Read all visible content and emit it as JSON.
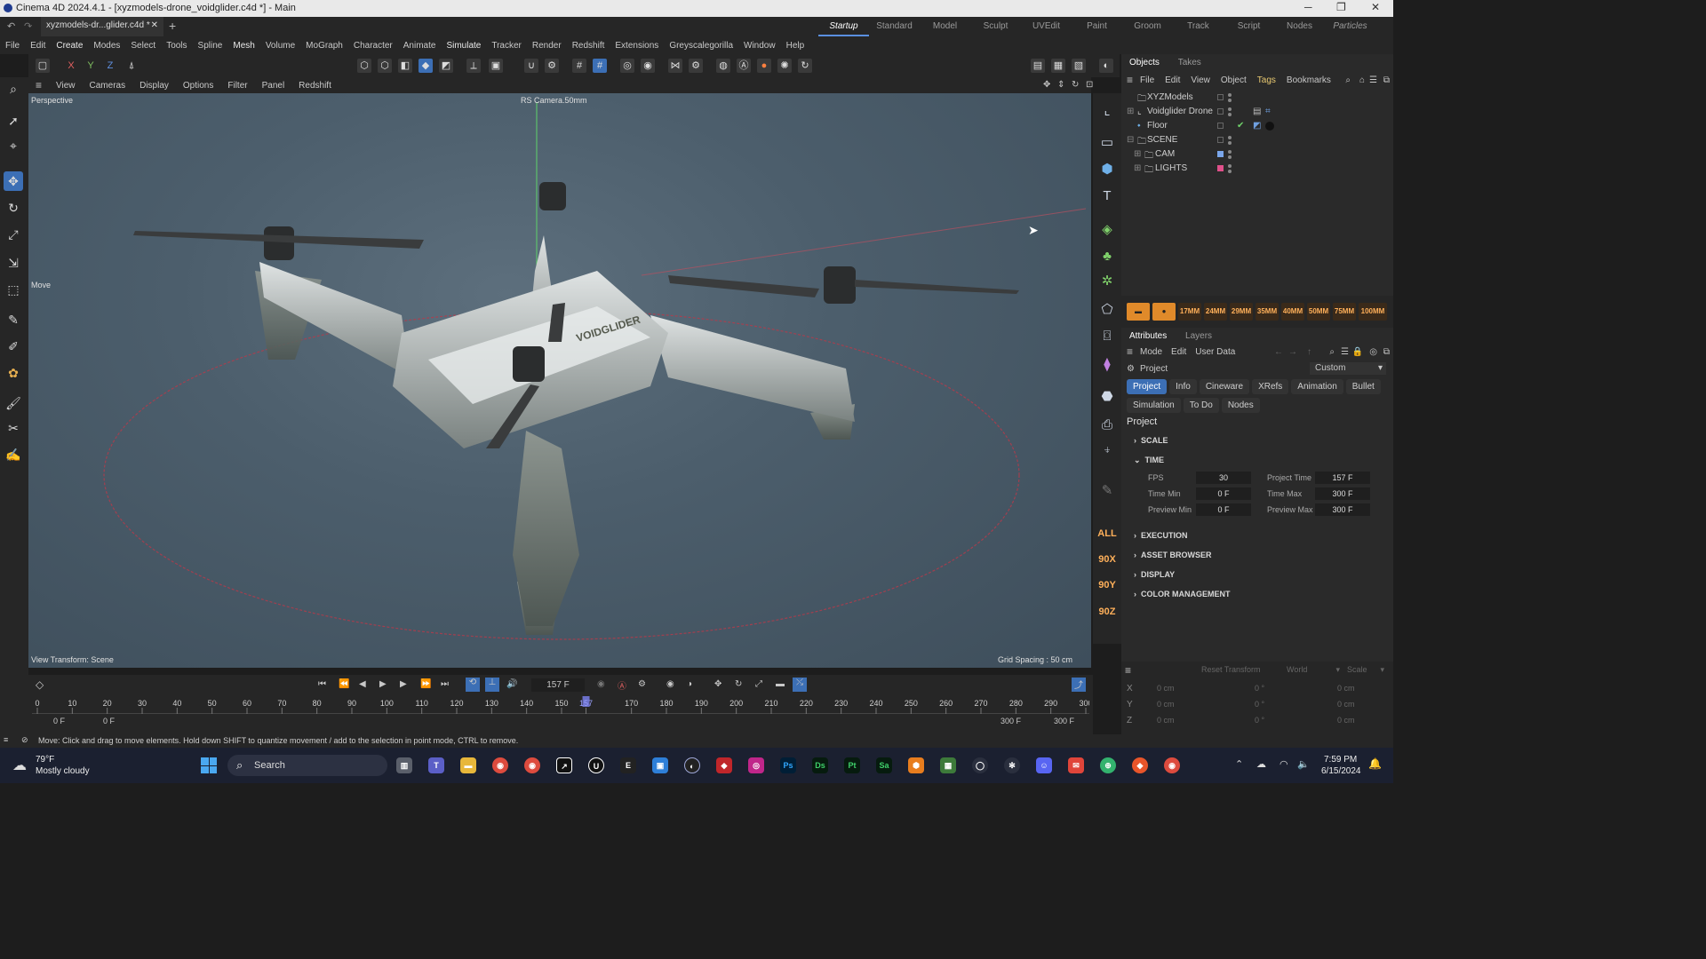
{
  "window": {
    "title": "Cinema 4D 2024.4.1 - [xyzmodels-drone_voidglider.c4d *] - Main",
    "minimize": "─",
    "maximize": "❐",
    "close": "✕"
  },
  "tabbar": {
    "doc_tab": "xyzmodels-dr...glider.c4d *",
    "close": "✕",
    "add": "+",
    "layouts": [
      "Startup",
      "Standard",
      "Model",
      "Sculpt",
      "UVEdit",
      "Paint",
      "Groom",
      "Track",
      "Script",
      "Nodes",
      "Particles"
    ],
    "active_layout": "Startup"
  },
  "menubar": [
    "File",
    "Edit",
    "Create",
    "Modes",
    "Select",
    "Tools",
    "Spline",
    "Mesh",
    "Volume",
    "MoGraph",
    "Character",
    "Animate",
    "Simulate",
    "Tracker",
    "Render",
    "Redshift",
    "Extensions",
    "Greyscalegorilla",
    "Window",
    "Help"
  ],
  "toolbar": {
    "x": "X",
    "y": "Y",
    "z": "Z"
  },
  "viewport": {
    "menu": [
      "View",
      "Cameras",
      "Display",
      "Options",
      "Filter",
      "Panel",
      "Redshift"
    ],
    "label": "Perspective",
    "camera": "RS Camera.50mm",
    "tool": "Move",
    "view_transform": "View Transform: Scene",
    "grid_spacing": "Grid Spacing : 50 cm",
    "drone_logo": "VOIDGLIDER"
  },
  "objects_panel": {
    "tabs": [
      "Objects",
      "Takes"
    ],
    "menu": [
      "File",
      "Edit",
      "View",
      "Object",
      "Tags",
      "Bookmarks"
    ],
    "items": [
      {
        "name": "XYZModels"
      },
      {
        "name": "Voidglider Drone"
      },
      {
        "name": "Floor"
      },
      {
        "name": "SCENE"
      },
      {
        "name": "CAM"
      },
      {
        "name": "LIGHTS"
      }
    ]
  },
  "lens_presets": [
    "17MM",
    "24MM",
    "29MM",
    "35MM",
    "40MM",
    "50MM",
    "75MM",
    "100MM"
  ],
  "attributes": {
    "tabs": [
      "Attributes",
      "Layers"
    ],
    "menu": [
      "Mode",
      "Edit",
      "User Data"
    ],
    "object": "Project",
    "preset": "Custom",
    "tab_buttons": [
      "Project",
      "Info",
      "Cineware",
      "XRefs",
      "Animation",
      "Bullet",
      "Simulation",
      "To Do",
      "Nodes"
    ],
    "heading": "Project",
    "sections": [
      "SCALE",
      "TIME",
      "EXECUTION",
      "ASSET BROWSER",
      "DISPLAY",
      "COLOR MANAGEMENT"
    ],
    "fields": {
      "fps_label": "FPS",
      "fps": "30",
      "project_time_label": "Project Time",
      "project_time": "157 F",
      "time_min_label": "Time Min",
      "time_min": "0 F",
      "time_max_label": "Time Max",
      "time_max": "300 F",
      "preview_min_label": "Preview Min",
      "preview_min": "0 F",
      "preview_max_label": "Preview Max",
      "preview_max": "300 F"
    }
  },
  "coords": {
    "reset": "Reset Transform",
    "world": "World",
    "scale": "Scale",
    "axes": [
      "X",
      "Y",
      "Z"
    ],
    "pos": "0 cm",
    "rot": "0 °",
    "size": "0 cm"
  },
  "timeline": {
    "current_frame": "157 F",
    "ticks": [
      "0",
      "10",
      "20",
      "30",
      "40",
      "50",
      "60",
      "70",
      "80",
      "90",
      "100",
      "110",
      "120",
      "130",
      "140",
      "150",
      "157",
      "170",
      "180",
      "190",
      "200",
      "210",
      "220",
      "230",
      "240",
      "250",
      "260",
      "270",
      "280",
      "290",
      "300"
    ],
    "start": "0 F",
    "start2": "0 F",
    "end": "300 F",
    "end2": "300 F"
  },
  "rightstrip": {
    "all": "ALL",
    "x": "90X",
    "y": "90Y",
    "z": "90Z"
  },
  "status": "Move: Click and drag to move elements. Hold down SHIFT to quantize movement / add to the selection in point mode, CTRL to remove.",
  "taskbar": {
    "weather_temp": "79°F",
    "weather_desc": "Mostly cloudy",
    "search": "Search",
    "time": "7:59 PM",
    "date": "6/15/2024",
    "apps": [
      "Ps",
      "Ds",
      "Pt",
      "Sa"
    ]
  },
  "colors": {
    "accent": "#3c6fb5",
    "cam_tag": "#7aa6ea",
    "lights_tag": "#e0508a"
  }
}
